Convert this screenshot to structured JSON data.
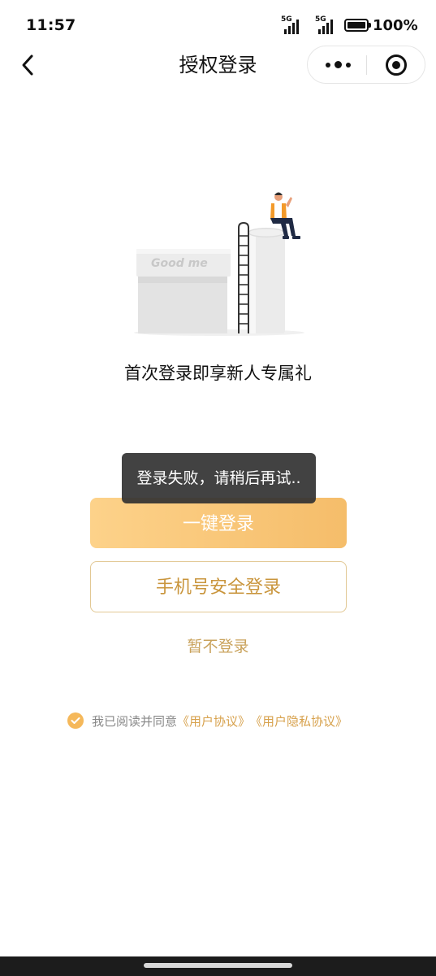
{
  "status_bar": {
    "time": "11:57",
    "sim1_network": "5G",
    "sim2_network": "5G",
    "battery": "100%"
  },
  "nav": {
    "title": "授权登录",
    "back_icon": "chevron-left-icon",
    "more_icon": "more-dots-icon",
    "close_icon": "mini-program-close-icon"
  },
  "illustration": {
    "brand_text": "Good me",
    "description_icon": "login-illustration"
  },
  "promo_text": "首次登录即享新人专属礼",
  "toast": {
    "message": "登录失败，请稍后再试.."
  },
  "buttons": {
    "one_click_login": "一键登录",
    "phone_login": "手机号安全登录",
    "skip": "暂不登录"
  },
  "agreement": {
    "checked": true,
    "prefix": "我已阅读并同意",
    "user_agreement": "《用户协议》",
    "privacy_agreement": "《用户隐私协议》"
  },
  "colors": {
    "primary_gradient_start": "#fdd28a",
    "primary_gradient_end": "#f5bd6a",
    "accent_text": "#c9953c",
    "link_text": "#d7a14c",
    "toast_bg": "#323232"
  }
}
